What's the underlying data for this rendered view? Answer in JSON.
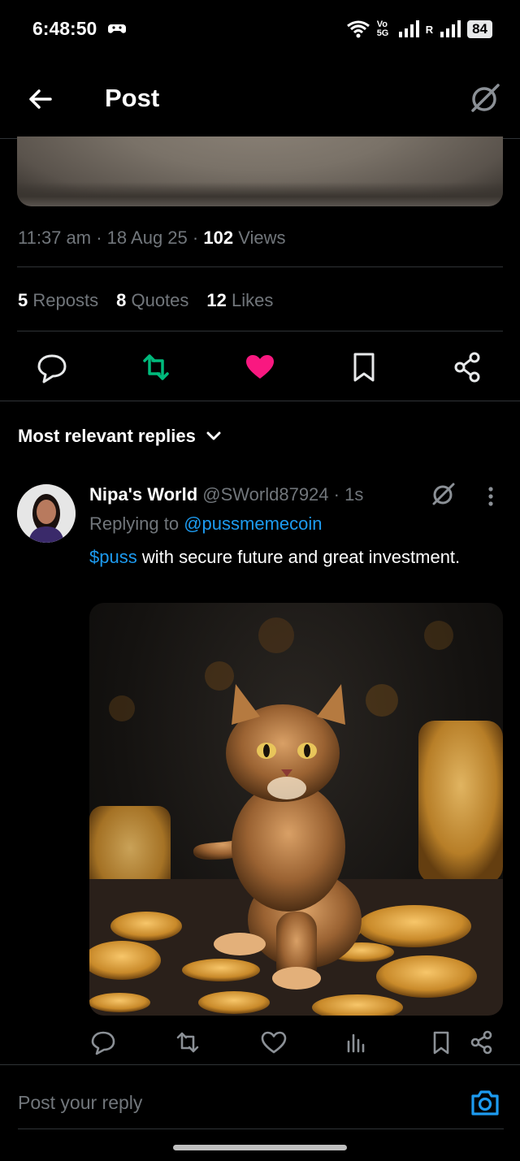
{
  "status_bar": {
    "time": "6:48:50",
    "network_tag": "Vo 5G",
    "roaming": "R",
    "battery": "84"
  },
  "header": {
    "title": "Post"
  },
  "post": {
    "time": "11:37 am",
    "date": "18 Aug 25",
    "views_count": "102",
    "views_label": "Views",
    "reposts_count": "5",
    "reposts_label": "Reposts",
    "quotes_count": "8",
    "quotes_label": "Quotes",
    "likes_count": "12",
    "likes_label": "Likes"
  },
  "colors": {
    "accent": "#1d9bf0",
    "repost_green": "#00ba7c",
    "like_pink": "#f91880",
    "muted": "#71767b"
  },
  "replies_sort": {
    "label": "Most relevant replies"
  },
  "reply": {
    "name": "Nipa's World",
    "handle": "@SWorld87924",
    "age": "· 1s",
    "replying_prefix": "Replying to",
    "replying_to": "@pussmemecoin",
    "cashtag": "$puss",
    "text": " with secure future and great investment."
  },
  "composer": {
    "placeholder": "Post your reply"
  }
}
